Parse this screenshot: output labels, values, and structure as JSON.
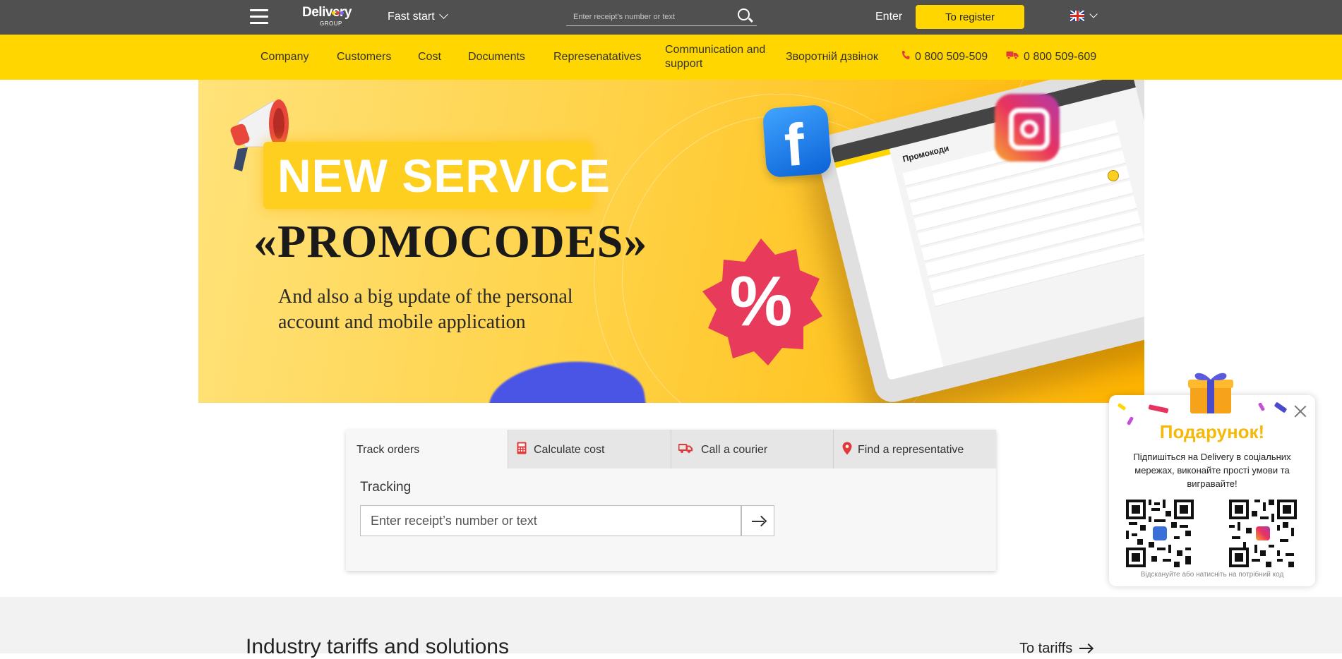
{
  "header": {
    "logo_text": "Delivery",
    "logo_sub": "GROUP",
    "fast_start_label": "Fast start",
    "search_placeholder": "Enter receipt’s number or text",
    "enter_label": "Enter",
    "register_label": "To register",
    "language": "EN"
  },
  "nav": {
    "items": [
      "Company",
      "Customers",
      "Cost",
      "Documents",
      "Represenatatives",
      "Communication and support",
      "Зворотній дзвінок"
    ],
    "phone_1": "0 800 509-509",
    "phone_2": "0 800 509-609"
  },
  "banner": {
    "headline": "NEW SERVICE",
    "promo": "«PROMOCODES»",
    "subtitle": "And also a big update of the personal account and mobile application",
    "percent_symbol": "%"
  },
  "tracker": {
    "tabs": [
      {
        "label": "Track orders",
        "icon": "none",
        "active": true
      },
      {
        "label": "Calculate cost",
        "icon": "calculator-icon",
        "active": false
      },
      {
        "label": "Call a courier",
        "icon": "truck-icon",
        "active": false
      },
      {
        "label": "Find a representative",
        "icon": "map-pin-icon",
        "active": false
      }
    ],
    "section_label": "Tracking",
    "input_placeholder": "Enter receipt’s number or text"
  },
  "lower": {
    "title": "Industry tariffs and solutions",
    "tariffs_link": "To tariffs"
  },
  "gift_popup": {
    "title": "Подарунок!",
    "text": "Підпишіться на Delivery в соціальних мережах, виконайте прості умови та вигравайте!",
    "caption": "Відскануйте або натисніть на потрібний код"
  },
  "colors": {
    "topbar": "#505050",
    "accent_yellow": "#ffd600",
    "icon_red": "#e23a3a",
    "gift_title": "#f5b90a"
  }
}
